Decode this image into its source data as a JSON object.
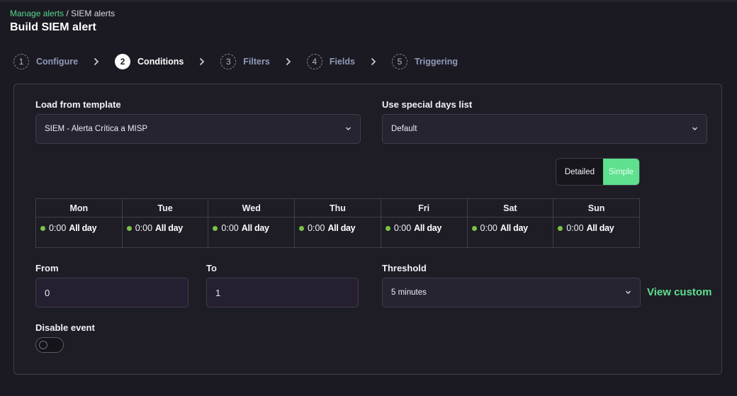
{
  "breadcrumb": {
    "link": "Manage alerts",
    "separator": " / ",
    "current": "SIEM alerts"
  },
  "page": {
    "title": "Build SIEM alert"
  },
  "steps": [
    {
      "num": "1",
      "label": "Configure",
      "active": false
    },
    {
      "num": "2",
      "label": "Conditions",
      "active": true
    },
    {
      "num": "3",
      "label": "Filters",
      "active": false
    },
    {
      "num": "4",
      "label": "Fields",
      "active": false
    },
    {
      "num": "5",
      "label": "Triggering",
      "active": false
    }
  ],
  "template": {
    "label": "Load from template",
    "value": "SIEM - Alerta Crítica a MISP"
  },
  "special_days": {
    "label": "Use special days list",
    "value": "Default"
  },
  "view_toggle": {
    "detailed": "Detailed",
    "simple": "Simple",
    "selected": "Simple"
  },
  "schedule": {
    "days": [
      "Mon",
      "Tue",
      "Wed",
      "Thu",
      "Fri",
      "Sat",
      "Sun"
    ],
    "slots": [
      {
        "time": "0:00",
        "range": "All day"
      },
      {
        "time": "0:00",
        "range": "All day"
      },
      {
        "time": "0:00",
        "range": "All day"
      },
      {
        "time": "0:00",
        "range": "All day"
      },
      {
        "time": "0:00",
        "range": "All day"
      },
      {
        "time": "0:00",
        "range": "All day"
      },
      {
        "time": "0:00",
        "range": "All day"
      }
    ]
  },
  "from": {
    "label": "From",
    "value": "0"
  },
  "to": {
    "label": "To",
    "value": "1"
  },
  "threshold": {
    "label": "Threshold",
    "value": "5 minutes",
    "view_custom": "View custom"
  },
  "disable_event": {
    "label": "Disable event",
    "enabled": false
  },
  "colors": {
    "accent": "#5ee08f",
    "dot": "#7cc243",
    "background": "#1b1a22"
  }
}
